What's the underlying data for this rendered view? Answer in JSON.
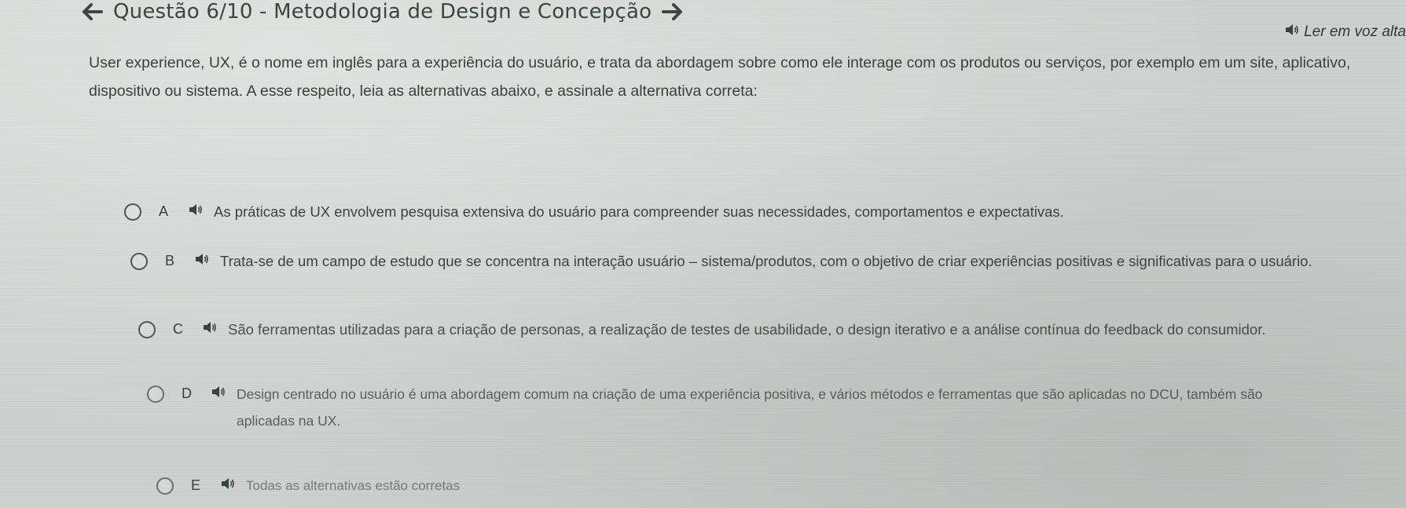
{
  "header": {
    "title": "Questão 6/10 - Metodologia de Design e Concepção",
    "prev_icon": "arrow-left-icon",
    "next_icon": "arrow-right-icon"
  },
  "read_aloud": {
    "label": "Ler em voz alta",
    "icon": "speaker-icon"
  },
  "question": {
    "statement": "User experience, UX, é o nome em inglês para a experiência do usuário, e trata da abordagem sobre como ele interage com os produtos ou serviços, por exemplo em um site, aplicativo, dispositivo ou sistema. A esse respeito, leia as alternativas abaixo, e assinale a alternativa correta:"
  },
  "options": [
    {
      "letter": "A",
      "text": "As práticas de UX envolvem pesquisa extensiva do usuário para compreender suas necessidades, comportamentos e expectativas."
    },
    {
      "letter": "B",
      "text": "Trata-se de um campo de estudo que se concentra na interação usuário – sistema/produtos, com o objetivo de criar experiências positivas e significativas para o usuário."
    },
    {
      "letter": "C",
      "text": "São ferramentas utilizadas para a criação de personas, a realização de testes de usabilidade, o design iterativo e a análise contínua do feedback do consumidor."
    },
    {
      "letter": "D",
      "text": "Design centrado no usuário é uma abordagem comum na criação de uma experiência positiva, e vários métodos e ferramentas que são aplicadas no DCU, também são aplicadas na UX."
    },
    {
      "letter": "E",
      "text": "Todas as alternativas estão corretas"
    }
  ],
  "colors": {
    "background": "#cfd2d0",
    "text": "#3a413d"
  }
}
